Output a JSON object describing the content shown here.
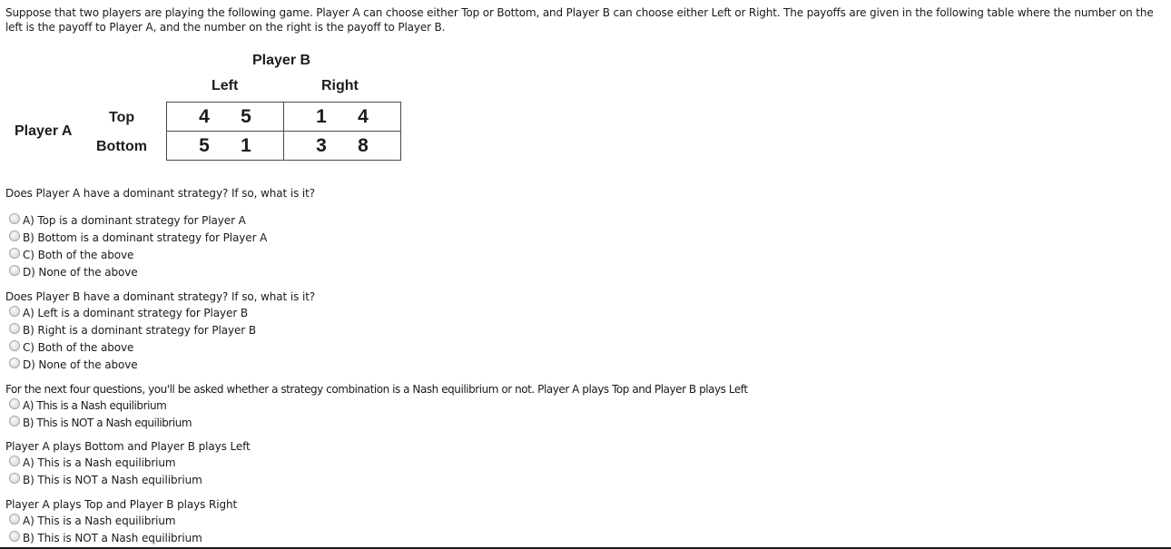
{
  "intro": "Suppose that two players are playing the following game. Player A can choose either Top or Bottom, and Player B can choose either Left or Right. The payoffs are given in the following table where the number on the left is the payoff to Player A, and the number on the right is the payoff to Player B.",
  "payoff_table": {
    "column_player": "Player B",
    "row_player": "Player A",
    "columns": [
      "Left",
      "Right"
    ],
    "rows": [
      {
        "label": "Top",
        "cells": [
          {
            "a": "4",
            "b": "5"
          },
          {
            "a": "1",
            "b": "4"
          }
        ]
      },
      {
        "label": "Bottom",
        "cells": [
          {
            "a": "5",
            "b": "1"
          },
          {
            "a": "3",
            "b": "8"
          }
        ]
      }
    ]
  },
  "questions": [
    {
      "prompt": "Does Player A have a dominant strategy? If so, what is it?",
      "options": [
        "A) Top is a dominant strategy for Player A",
        "B) Bottom is a dominant strategy for Player A",
        "C) Both of the above",
        "D) None of the above"
      ],
      "selected": null
    },
    {
      "prompt": "Does Player B have a dominant strategy? If so, what is it?",
      "options": [
        "A) Left is a dominant strategy for Player B",
        "B) Right is a dominant strategy for Player B",
        "C) Both of the above",
        "D) None of the above"
      ],
      "selected": null
    },
    {
      "prompt": "For the next four questions, you'll be asked whether a strategy combination is a Nash equilibrium or not. Player A plays Top and Player B plays Left",
      "options": [
        "A) This is a Nash equilibrium",
        "B) This is NOT a Nash equilibrium"
      ],
      "selected": null
    },
    {
      "prompt": "Player A plays Bottom and Player B plays Left",
      "options": [
        "A) This is a Nash equilibrium",
        "B) This is NOT a Nash equilibrium"
      ],
      "selected": null
    },
    {
      "prompt": "Player A plays Top and Player B plays Right",
      "options": [
        "A) This is a Nash equilibrium",
        "B) This is NOT a Nash equilibrium"
      ],
      "selected": null
    }
  ]
}
